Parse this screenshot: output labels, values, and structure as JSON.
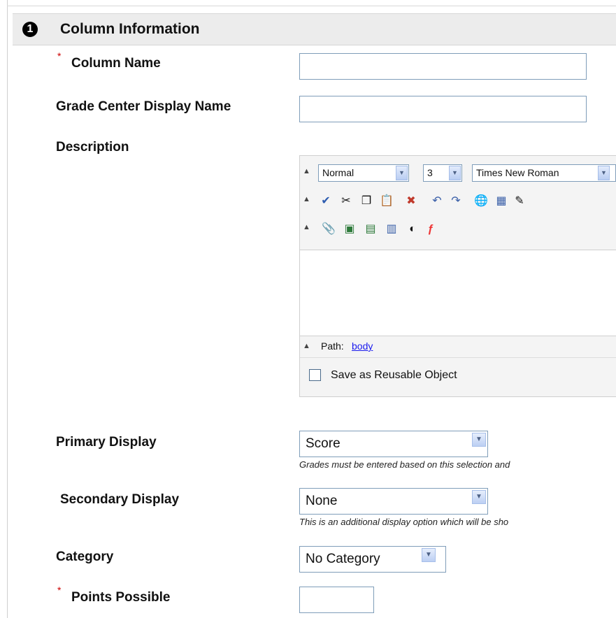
{
  "section": {
    "step": "1",
    "title": "Column Information"
  },
  "fields": {
    "column_name": {
      "required_mark": "*",
      "label": "Column Name",
      "value": ""
    },
    "display_name": {
      "label": "Grade Center Display Name",
      "value": ""
    },
    "description": {
      "label": "Description"
    },
    "primary_display": {
      "label": "Primary Display",
      "value": "Score",
      "hint": "Grades must be entered based on this selection and"
    },
    "secondary_display": {
      "label": "Secondary Display",
      "value": "None",
      "hint": "This is an additional display option which will be sho"
    },
    "category": {
      "label": "Category",
      "value": "No Category"
    },
    "points_possible": {
      "required_mark": "*",
      "label": "Points Possible",
      "value": ""
    }
  },
  "editor": {
    "format": "Normal",
    "size": "3",
    "font": "Times New Roman",
    "path_label": "Path:",
    "path_link": "body",
    "reusable_label": "Save as Reusable Object",
    "toolbar_row2": [
      "spellcheck-icon",
      "cut-icon",
      "copy-icon",
      "paste-icon",
      "remove-format-icon",
      "undo-icon",
      "redo-icon",
      "link-icon",
      "table-icon",
      "pen-icon"
    ],
    "toolbar_row3": [
      "attach-file-icon",
      "image-icon",
      "media-icon",
      "page-icon",
      "audio-icon",
      "flash-icon"
    ]
  }
}
